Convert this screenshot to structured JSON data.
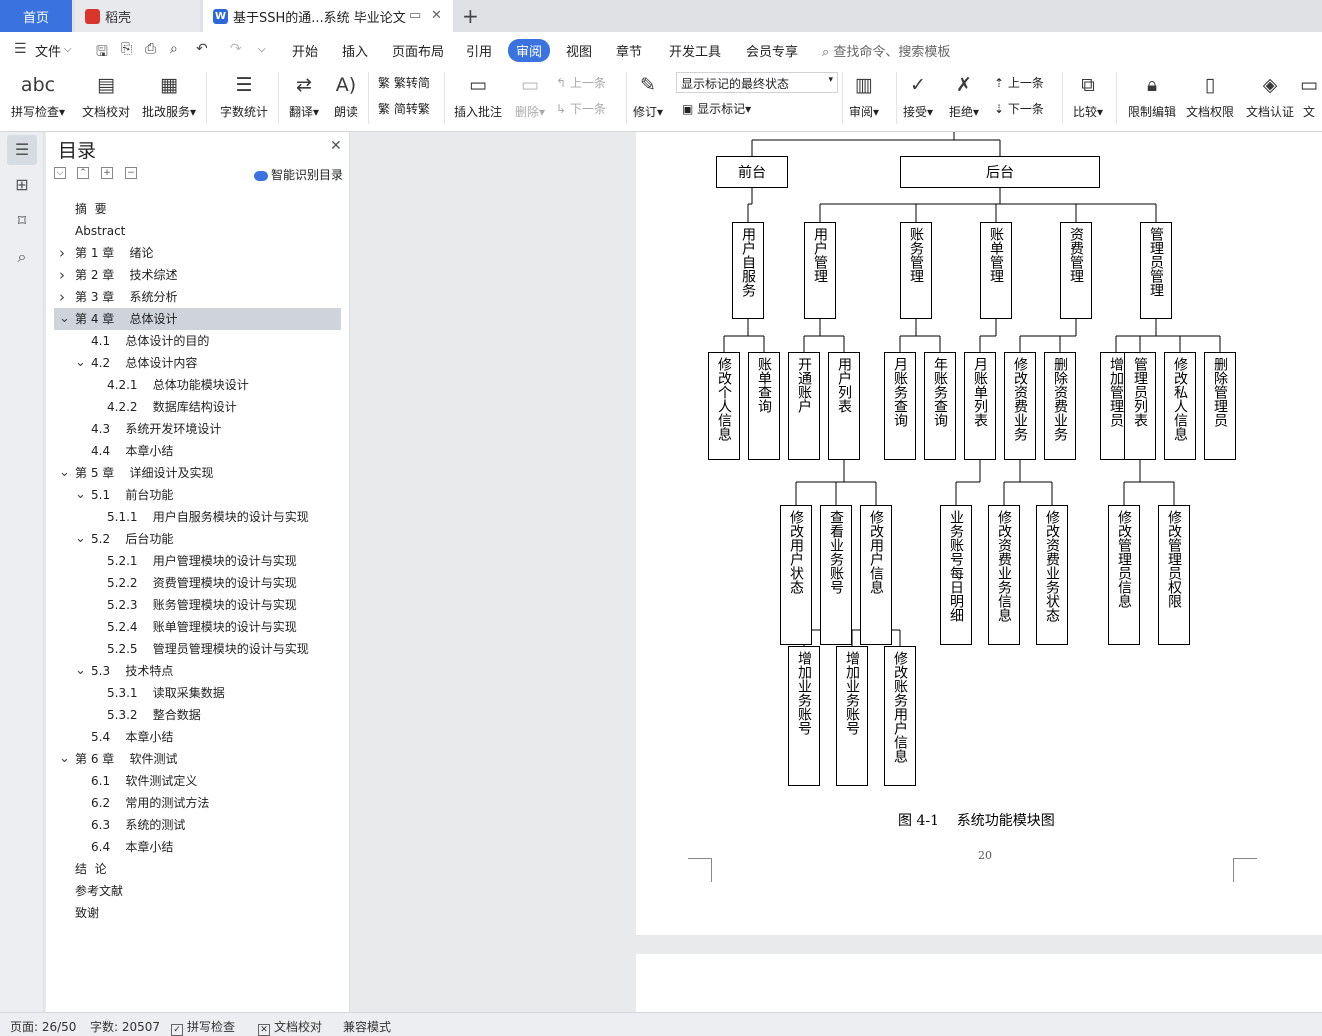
{
  "tabs": {
    "home": "首页",
    "daoke": "稻壳",
    "document": "基于SSH的通...系统 毕业论文"
  },
  "menu": {
    "file": "文件",
    "items": [
      "开始",
      "插入",
      "页面布局",
      "引用",
      "审阅",
      "视图",
      "章节",
      "开发工具",
      "会员专享"
    ],
    "active": "审阅",
    "search_placeholder": "查找命令、搜索模板"
  },
  "ribbon": {
    "spell_check": "拼写检查",
    "doc_proof": "文档校对",
    "revise_service": "批改服务",
    "word_count": "字数统计",
    "translate": "翻译",
    "read_aloud": "朗读",
    "to_traditional": "繁转简",
    "to_simplified": "简转繁",
    "insert_comment": "插入批注",
    "delete": "删除",
    "prev_comment": "上一条",
    "next_comment": "下一条",
    "track_changes": "修订",
    "markup_state": "显示标记的最终状态",
    "show_markup": "显示标记",
    "review_pane": "审阅",
    "accept": "接受",
    "reject": "拒绝",
    "prev_change": "上一条",
    "next_change": "下一条",
    "compare": "比较",
    "restrict_edit": "限制编辑",
    "doc_permission": "文档权限",
    "doc_cert": "文档认证",
    "more": "文"
  },
  "toc": {
    "title": "目录",
    "smart_toc": "智能识别目录",
    "items": [
      {
        "text": "摘  要"
      },
      {
        "text": "Abstract"
      },
      {
        "text": "第 1 章    绪论"
      },
      {
        "text": "第 2 章    技术综述"
      },
      {
        "text": "第 3 章    系统分析"
      },
      {
        "text": "第 4 章    总体设计"
      },
      {
        "text": "4.1    总体设计的目的"
      },
      {
        "text": "4.2    总体设计内容"
      },
      {
        "text": "4.2.1    总体功能模块设计"
      },
      {
        "text": "4.2.2    数据库结构设计"
      },
      {
        "text": "4.3    系统开发环境设计"
      },
      {
        "text": "4.4    本章小结"
      },
      {
        "text": "第 5 章    详细设计及实现"
      },
      {
        "text": "5.1    前台功能"
      },
      {
        "text": "5.1.1    用户自服务模块的设计与实现"
      },
      {
        "text": "5.2    后台功能"
      },
      {
        "text": "5.2.1    用户管理模块的设计与实现"
      },
      {
        "text": "5.2.2    资费管理模块的设计与实现"
      },
      {
        "text": "5.2.3    账务管理模块的设计与实现"
      },
      {
        "text": "5.2.4    账单管理模块的设计与实现"
      },
      {
        "text": "5.2.5    管理员管理模块的设计与实现"
      },
      {
        "text": "5.3    技术特点"
      },
      {
        "text": "5.3.1    读取采集数据"
      },
      {
        "text": "5.3.2    整合数据"
      },
      {
        "text": "5.4    本章小结"
      },
      {
        "text": "第 6 章    软件测试"
      },
      {
        "text": "6.1    软件测试定义"
      },
      {
        "text": "6.2    常用的测试方法"
      },
      {
        "text": "6.3    系统的测试"
      },
      {
        "text": "6.4    本章小结"
      },
      {
        "text": "结  论"
      },
      {
        "text": "参考文献"
      },
      {
        "text": "致谢"
      }
    ]
  },
  "diagram": {
    "level1": [
      "前台",
      "后台"
    ],
    "level2": [
      "用户自服务",
      "用户管理",
      "账务管理",
      "账单管理",
      "资费管理",
      "管理员管理"
    ],
    "level3": [
      "修改个人信息",
      "账单查询",
      "开通账户",
      "用户列表",
      "月账务查询",
      "年账务查询",
      "月账单列表",
      "修改资费业务",
      "删除资费业务",
      "增加管理员",
      "管理员列表",
      "修改私人信息",
      "删除管理员"
    ],
    "level4": [
      "修改用户状态",
      "查看业务账号",
      "修改用户信息",
      "业务账号每日明细",
      "修改资费业务信息",
      "修改资费业务状态",
      "修改管理员信息",
      "修改管理员权限"
    ],
    "level5": [
      "增加业务账号",
      "增加业务账号",
      "修改账务用户信息"
    ],
    "caption": "图 4-1    系统功能模块图",
    "page_number": "20"
  },
  "status": {
    "page": "页面: 26/50",
    "words": "字数: 20507",
    "spell_check": "拼写检查",
    "doc_proof": "文档校对",
    "compat_mode": "兼容模式"
  }
}
